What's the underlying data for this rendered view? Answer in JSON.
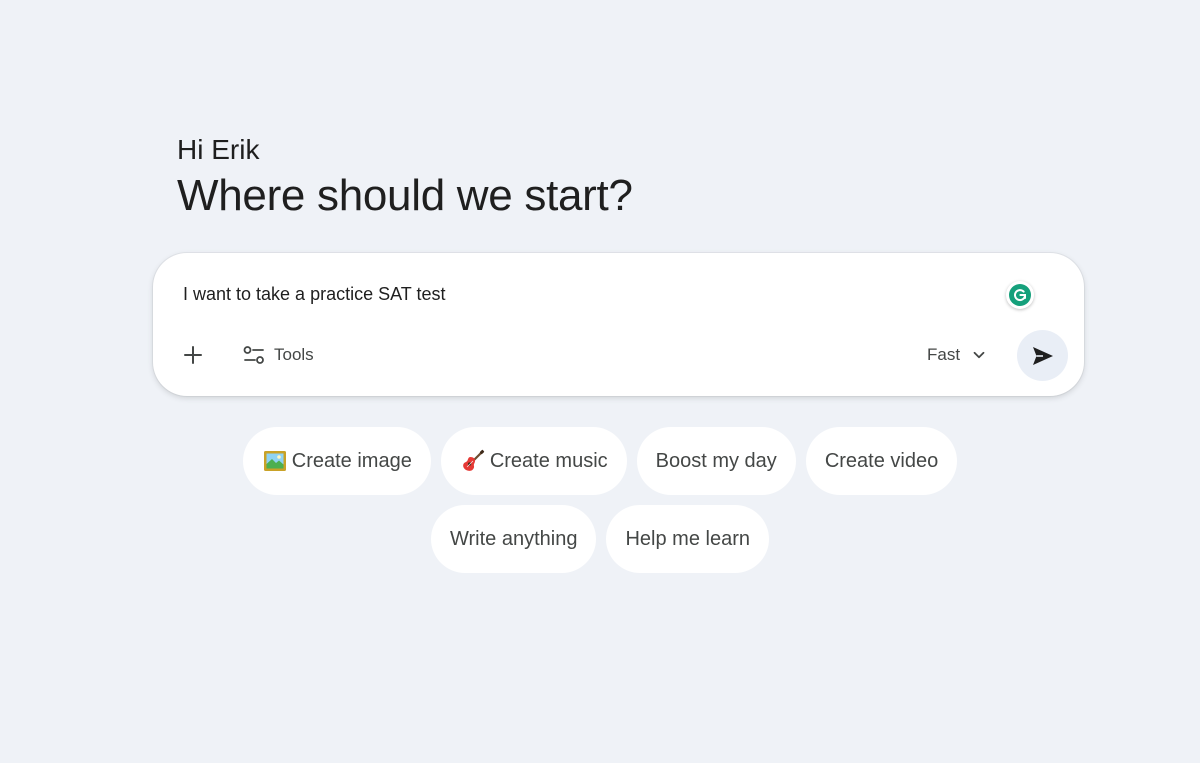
{
  "greeting": "Hi Erik",
  "headline": "Where should we start?",
  "composer": {
    "input_value": "I want to take a practice SAT test",
    "plus_icon": "plus-icon",
    "tools_label": "Tools",
    "tools_icon": "tools-sliders-icon",
    "model_label": "Fast",
    "model_icon": "chevron-down-icon",
    "send_icon": "send-icon",
    "extension_icon": "grammarly-icon"
  },
  "chips": {
    "row1": [
      {
        "label": "Create image",
        "icon": "picture-icon"
      },
      {
        "label": "Create music",
        "icon": "guitar-icon"
      },
      {
        "label": "Boost my day",
        "icon": ""
      },
      {
        "label": "Create video",
        "icon": ""
      }
    ],
    "row2": [
      {
        "label": "Write anything",
        "icon": ""
      },
      {
        "label": "Help me learn",
        "icon": ""
      }
    ]
  },
  "colors": {
    "background": "#eff2f7",
    "card": "#ffffff",
    "text": "#1f1f1f",
    "muted_text": "#444746",
    "send_button_bg": "#e9eef6",
    "grammarly": "#15a07b"
  }
}
